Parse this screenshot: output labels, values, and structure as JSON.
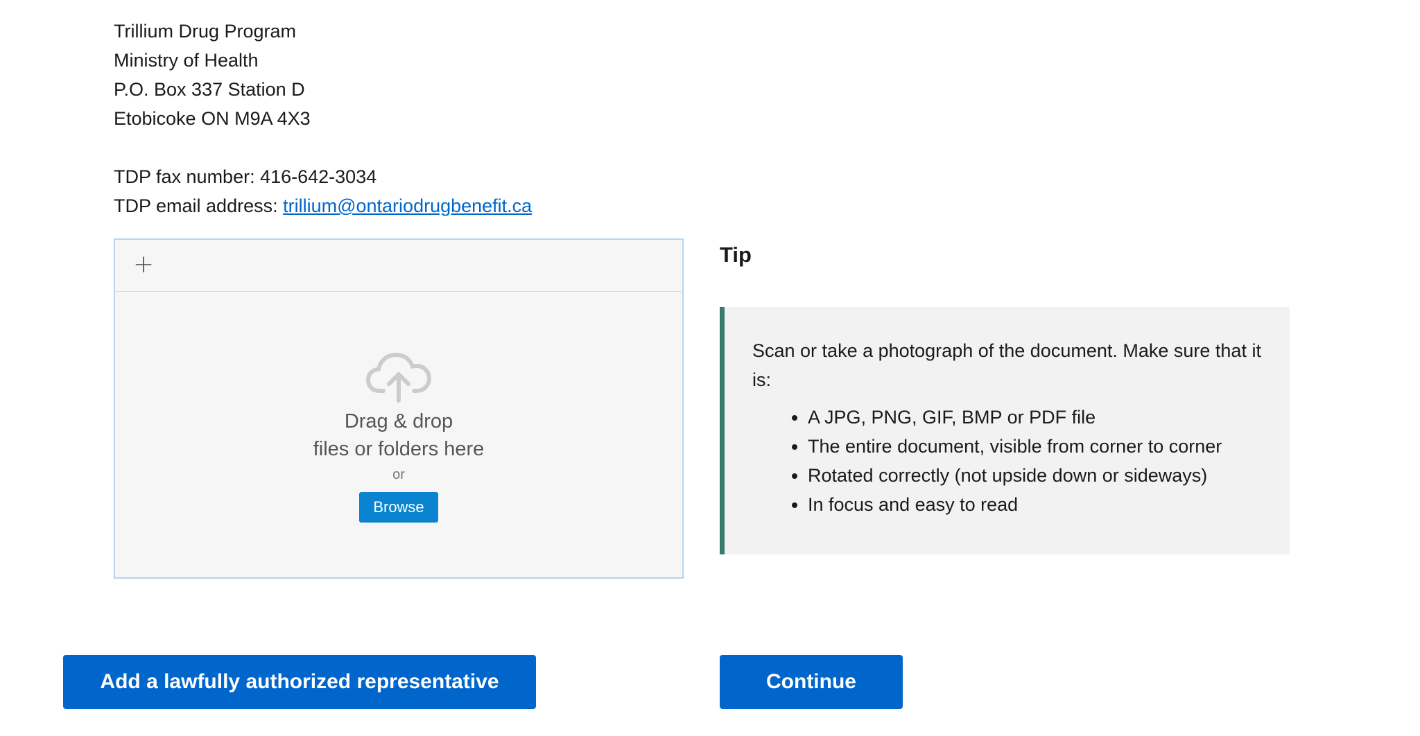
{
  "address": {
    "lines": [
      "Trillium Drug Program",
      "Ministry of Health",
      "P.O. Box 337 Station D",
      "Etobicoke ON M9A 4X3"
    ],
    "fax_label": "TDP fax number: 416-642-3034",
    "email_label": "TDP email address: ",
    "email_link": "trillium@ontariodrugbenefit.ca"
  },
  "uploader": {
    "add_icon": "plus-icon",
    "cloud_icon": "cloud-upload-icon",
    "drop_line1": "Drag & drop",
    "drop_line2": "files or folders here",
    "or": "or",
    "browse_label": "Browse"
  },
  "tip": {
    "title": "Tip",
    "intro": "Scan or take a photograph of the document. Make sure that it is:",
    "items": [
      "A JPG, PNG, GIF, BMP or PDF file",
      "The entire document, visible from corner to corner",
      "Rotated correctly (not upside down or sideways)",
      "In focus and easy to read"
    ]
  },
  "buttons": {
    "add_rep": "Add a lawfully authorized representative",
    "continue": "Continue"
  },
  "colors": {
    "primary": "#0066cc",
    "browse": "#0a84d0",
    "tip_accent": "#3b7a6e",
    "tip_bg": "#f2f2f2"
  }
}
